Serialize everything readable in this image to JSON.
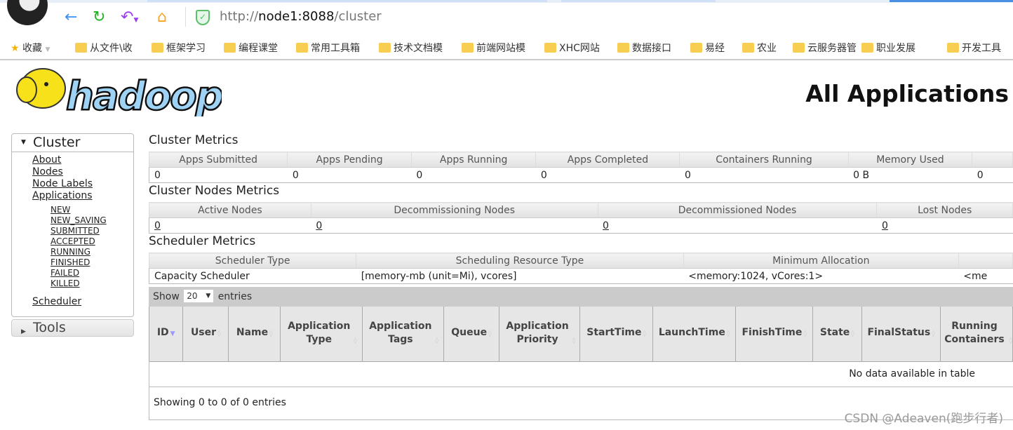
{
  "browser": {
    "url_prefix": "http://",
    "url_host": "node1:8088",
    "url_path": "/cluster",
    "bookmarks": [
      "收藏",
      "从文件\\收",
      "框架学习",
      "编程课堂",
      "常用工具箱",
      "技术文档模",
      "前端网站模",
      "XHC网站",
      "数据接口",
      "易经",
      "农业",
      "云服务器管",
      "职业发展",
      "开发工具"
    ]
  },
  "page": {
    "logo_text": "hadoop",
    "title": "All Applications"
  },
  "sidebar": {
    "cluster_label": "Cluster",
    "links": [
      "About",
      "Nodes",
      "Node Labels",
      "Applications"
    ],
    "app_states": [
      "NEW",
      "NEW_SAVING",
      "SUBMITTED",
      "ACCEPTED",
      "RUNNING",
      "FINISHED",
      "FAILED",
      "KILLED"
    ],
    "scheduler": "Scheduler",
    "tools_label": "Tools"
  },
  "cluster_metrics": {
    "title": "Cluster Metrics",
    "headers": [
      "Apps Submitted",
      "Apps Pending",
      "Apps Running",
      "Apps Completed",
      "Containers Running",
      "Memory Used",
      ""
    ],
    "values": [
      "0",
      "0",
      "0",
      "0",
      "0",
      "0 B",
      "0"
    ]
  },
  "nodes_metrics": {
    "title": "Cluster Nodes Metrics",
    "headers": [
      "Active Nodes",
      "Decommissioning Nodes",
      "Decommissioned Nodes",
      "Lost Nodes"
    ],
    "values": [
      "0",
      "0",
      "0",
      "0"
    ]
  },
  "scheduler_metrics": {
    "title": "Scheduler Metrics",
    "headers": [
      "Scheduler Type",
      "Scheduling Resource Type",
      "Minimum Allocation",
      ""
    ],
    "values": [
      "Capacity Scheduler",
      "[memory-mb (unit=Mi), vcores]",
      "<memory:1024, vCores:1>",
      "<me"
    ]
  },
  "apps": {
    "show_label": "Show",
    "page_size": "20",
    "entries_label": "entries",
    "columns": [
      "ID",
      "User",
      "Name",
      "Application Type",
      "Application Tags",
      "Queue",
      "Application Priority",
      "StartTime",
      "LaunchTime",
      "FinishTime",
      "State",
      "FinalStatus",
      "Running Containers"
    ],
    "empty_text": "No data available in table",
    "footer": "Showing 0 to 0 of 0 entries"
  },
  "watermark": "CSDN @Adeaven(跑步行者)",
  "colors": {
    "header_bg": "#e6e6e6",
    "controls_bg": "#cbcbcb",
    "logo_yellow": "#f7e11b",
    "logo_blue": "#9fd3f5"
  }
}
